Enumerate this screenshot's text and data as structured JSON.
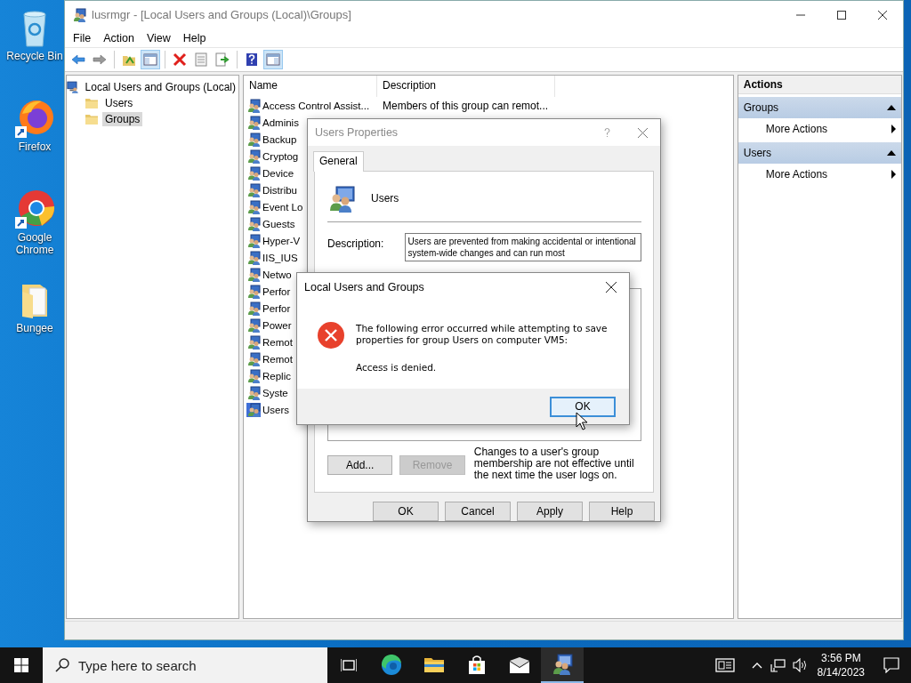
{
  "desktop_icons": [
    {
      "label": "Recycle Bin",
      "kind": "recycle"
    },
    {
      "label": "Firefox",
      "kind": "firefox"
    },
    {
      "label": "Google Chrome",
      "kind": "chrome"
    },
    {
      "label": "Bungee",
      "kind": "folder"
    }
  ],
  "window": {
    "title": "lusrmgr - [Local Users and Groups (Local)\\Groups]",
    "menu": [
      "File",
      "Action",
      "View",
      "Help"
    ],
    "toolbar": [
      {
        "kind": "back",
        "pressed": false
      },
      {
        "kind": "forward",
        "pressed": false
      },
      {
        "kind": "sep"
      },
      {
        "kind": "up",
        "pressed": false
      },
      {
        "kind": "tree",
        "pressed": true
      },
      {
        "kind": "sep"
      },
      {
        "kind": "delete",
        "pressed": false
      },
      {
        "kind": "properties",
        "pressed": false
      },
      {
        "kind": "export",
        "pressed": false
      },
      {
        "kind": "sep"
      },
      {
        "kind": "help",
        "pressed": false
      },
      {
        "kind": "actionpane",
        "pressed": true
      }
    ],
    "tree": {
      "label": "Local Users and Groups (Local)",
      "children": [
        {
          "label": "Users",
          "selected": false
        },
        {
          "label": "Groups",
          "selected": true
        }
      ]
    },
    "list": {
      "columns": [
        "Name",
        "Description"
      ],
      "rows": [
        {
          "name": "Access Control Assist...",
          "description": "Members of this group can remot...",
          "selected": false
        },
        {
          "name": "Adminis",
          "selected": false
        },
        {
          "name": "Backup",
          "selected": false
        },
        {
          "name": "Cryptog",
          "selected": false
        },
        {
          "name": "Device",
          "selected": false
        },
        {
          "name": "Distribu",
          "selected": false
        },
        {
          "name": "Event Lo",
          "selected": false
        },
        {
          "name": "Guests",
          "selected": false
        },
        {
          "name": "Hyper-V",
          "selected": false
        },
        {
          "name": "IIS_IUS",
          "selected": false
        },
        {
          "name": "Netwo",
          "selected": false
        },
        {
          "name": "Perfor",
          "selected": false
        },
        {
          "name": "Perfor",
          "selected": false
        },
        {
          "name": "Power",
          "selected": false
        },
        {
          "name": "Remot",
          "selected": false
        },
        {
          "name": "Remot",
          "selected": false
        },
        {
          "name": "Replic",
          "selected": false
        },
        {
          "name": "Syste",
          "selected": false
        },
        {
          "name": "Users",
          "selected": true
        }
      ]
    },
    "actions": {
      "title": "Actions",
      "sections": [
        {
          "title": "Groups",
          "items": [
            "More Actions"
          ]
        },
        {
          "title": "Users",
          "items": [
            "More Actions"
          ]
        }
      ]
    }
  },
  "properties_dialog": {
    "title": "Users Properties",
    "tabs": [
      {
        "label": "General",
        "selected": true
      }
    ],
    "group_name": "Users",
    "description_label": "Description:",
    "description": "Users are prevented from making accidental or intentional system-wide changes and can run most",
    "member_buttons": [
      {
        "label": "Add...",
        "disabled": false
      },
      {
        "label": "Remove",
        "disabled": true
      }
    ],
    "note": "Changes to a user's group membership are not effective until the next time the user logs on.",
    "buttons": [
      "OK",
      "Cancel",
      "Apply",
      "Help"
    ]
  },
  "error_dialog": {
    "title": "Local Users and Groups",
    "message": "The following error occurred while attempting to save properties for group Users on computer VM5:",
    "detail": "Access is denied.",
    "button": "OK"
  },
  "taskbar": {
    "search_placeholder": "Type here to search",
    "apps": [
      {
        "kind": "taskview",
        "active": false
      },
      {
        "kind": "edge",
        "active": false
      },
      {
        "kind": "explorer",
        "active": false
      },
      {
        "kind": "store",
        "active": false
      },
      {
        "kind": "mail",
        "active": false
      },
      {
        "kind": "lusrmgr",
        "active": true
      }
    ],
    "time": "3:56 PM",
    "date": "8/14/2023"
  }
}
